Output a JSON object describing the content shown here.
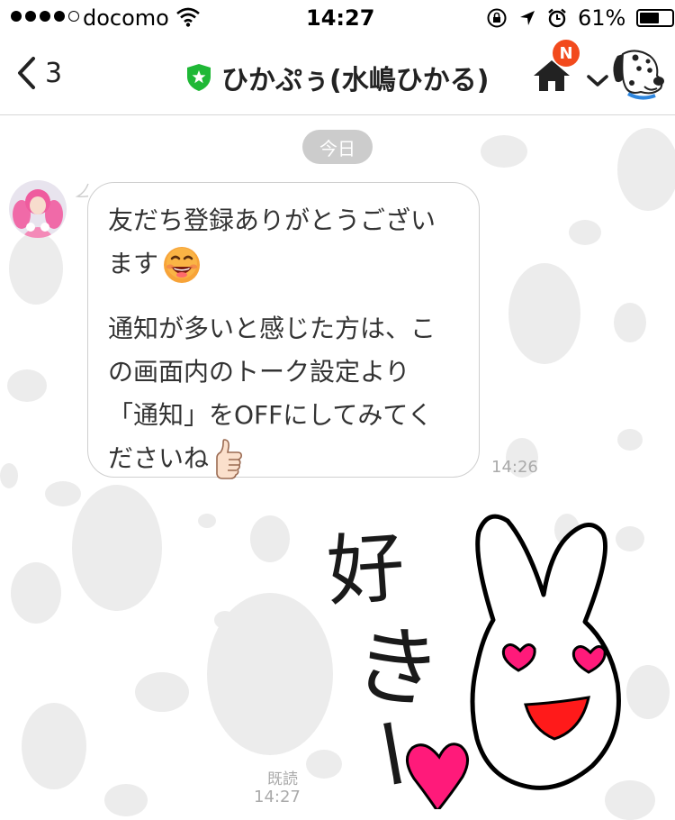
{
  "status_bar": {
    "carrier": "docomo",
    "time": "14:27",
    "battery_percent": "61%",
    "battery_level": 0.61,
    "icons": [
      "signal-dots",
      "wifi-icon",
      "rotation-lock-icon",
      "location-arrow-icon",
      "alarm-icon",
      "battery-icon"
    ]
  },
  "nav": {
    "back_count": "3",
    "title": "ひかぷぅ(水嶋ひかる)",
    "badge": "N",
    "icons": [
      "back-chevron-icon",
      "verified-star-icon",
      "home-icon",
      "dropdown-chevron-icon",
      "dalmatian-mascot-icon"
    ]
  },
  "chat": {
    "date_label": "今日",
    "message": {
      "lines": [
        "友だち登録ありがとうござい",
        "ます",
        "",
        "通知が多いと感じた方は、こ",
        "の画面内のトーク設定より",
        "「通知」をOFFにしてみてく",
        "ださいね"
      ],
      "time": "14:26",
      "emojis": [
        "grinning-face-icon",
        "thumbs-up-icon"
      ]
    },
    "sent": {
      "read_label": "既読",
      "time": "14:27",
      "sticker_text": [
        "好",
        "き",
        "ー"
      ]
    }
  },
  "colors": {
    "accent_green": "#1fb836",
    "badge_red": "#f24a1d",
    "heart_pink": "#ff1a7a",
    "mouth_red": "#ff1a1a"
  }
}
